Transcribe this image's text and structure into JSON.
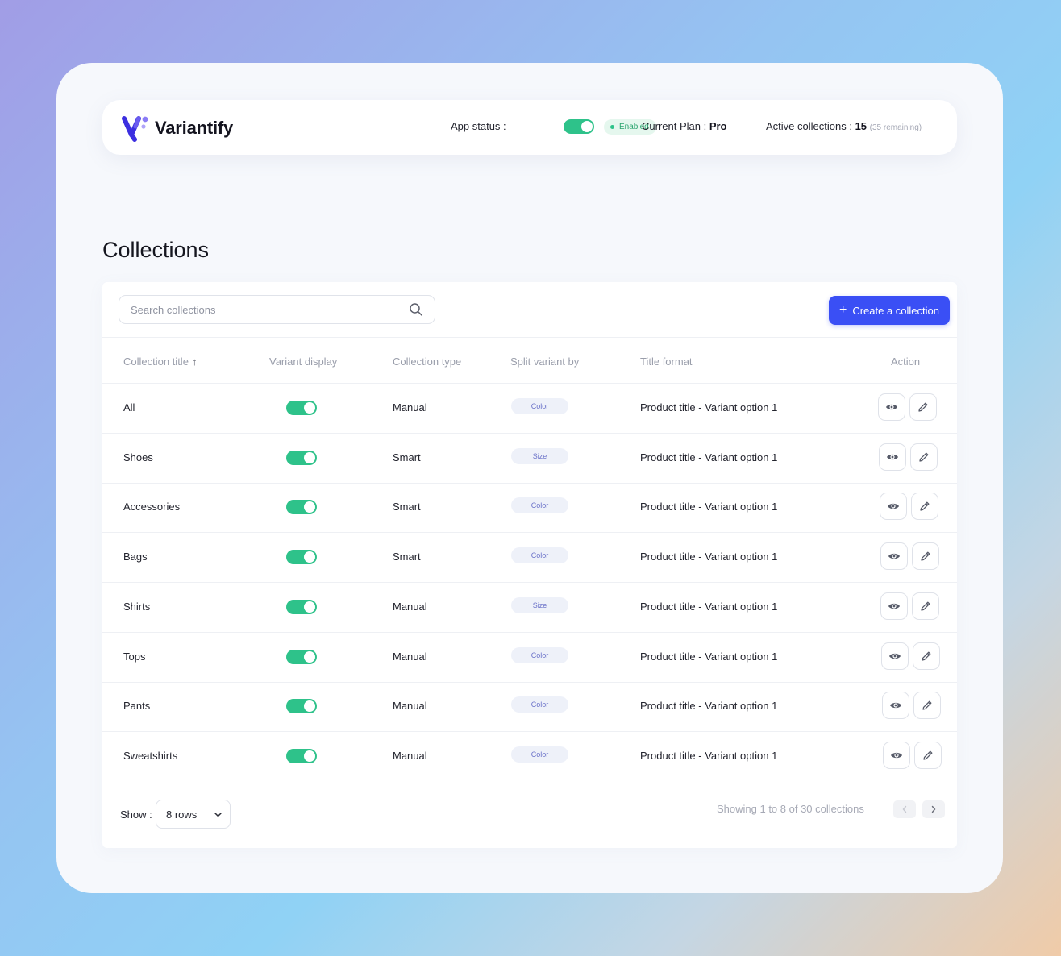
{
  "app": {
    "brand": "Variantify",
    "status_label": "App status :",
    "status_on": true,
    "status_badge": "Enabled",
    "plan_label": "Current Plan :",
    "plan_value": "Pro",
    "active_label": "Active collections :",
    "active_value": "15",
    "active_remaining": "(35 remaining)"
  },
  "colors": {
    "accent": "#3a4ff5",
    "toggle_on": "#2ec28a",
    "chip_text": "#6b72c9"
  },
  "page": {
    "title": "Collections"
  },
  "toolbar": {
    "search_placeholder": "Search collections",
    "create_label": "Create a collection",
    "create_icon": "plus-icon"
  },
  "table": {
    "headers": {
      "title": "Collection title",
      "variant_display": "Variant display",
      "type": "Collection type",
      "split": "Split variant by",
      "format": "Title format",
      "action": "Action"
    },
    "rows": [
      {
        "title": "All",
        "variant_display": true,
        "type": "Manual",
        "split": "Color",
        "format": "Product title - Variant option 1"
      },
      {
        "title": "Shoes",
        "variant_display": true,
        "type": "Smart",
        "split": "Size",
        "format": "Product title - Variant option 1"
      },
      {
        "title": "Accessories",
        "variant_display": true,
        "type": "Smart",
        "split": "Color",
        "format": "Product title - Variant option 1"
      },
      {
        "title": "Bags",
        "variant_display": true,
        "type": "Smart",
        "split": "Color",
        "format": "Product title - Variant option 1"
      },
      {
        "title": "Shirts",
        "variant_display": true,
        "type": "Manual",
        "split": "Size",
        "format": "Product title - Variant option 1"
      },
      {
        "title": "Tops",
        "variant_display": true,
        "type": "Manual",
        "split": "Color",
        "format": "Product title - Variant option 1"
      },
      {
        "title": "Pants",
        "variant_display": true,
        "type": "Manual",
        "split": "Color",
        "format": "Product title - Variant option 1"
      },
      {
        "title": "Sweatshirts",
        "variant_display": true,
        "type": "Manual",
        "split": "Color",
        "format": "Product title - Variant option 1"
      }
    ]
  },
  "footer": {
    "show_label": "Show :",
    "rows_value": "8 rows",
    "showing_text": "Showing 1 to 8 of 30 collections"
  }
}
